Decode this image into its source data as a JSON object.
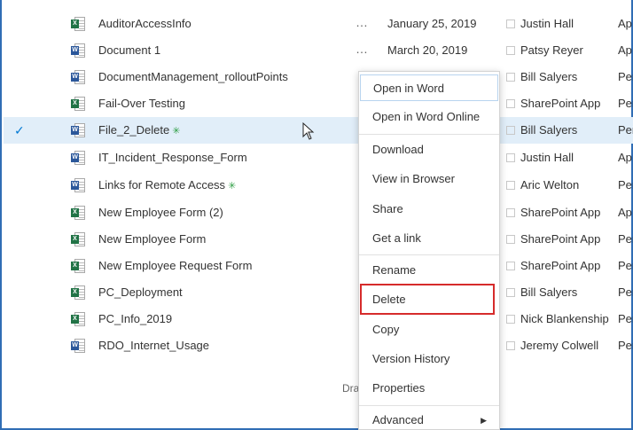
{
  "files": [
    {
      "name": "AuditorAccessInfo",
      "type": "excel",
      "new": false,
      "date": "January 25, 2019",
      "author": "Justin Hall",
      "extra": "Ap",
      "ellipsis": "…"
    },
    {
      "name": "Document 1",
      "type": "word",
      "new": false,
      "date": "March 20, 2019",
      "author": "Patsy Reyer",
      "extra": "Ap",
      "ellipsis": "…"
    },
    {
      "name": "DocumentManagement_rolloutPoints",
      "type": "word",
      "new": false,
      "date": "",
      "author": "Bill Salyers",
      "extra": "Per",
      "ellipsis": ""
    },
    {
      "name": "Fail-Over Testing",
      "type": "excel",
      "new": false,
      "date": "",
      "author": "SharePoint App",
      "extra": "Per",
      "ellipsis": ""
    },
    {
      "name": "File_2_Delete",
      "type": "word",
      "new": true,
      "selected": true,
      "date": "",
      "author": "Bill Salyers",
      "extra": "Per",
      "ellipsis": ""
    },
    {
      "name": "IT_Incident_Response_Form",
      "type": "word",
      "new": false,
      "date": "",
      "author": "Justin Hall",
      "extra": "Ap",
      "ellipsis": ""
    },
    {
      "name": "Links for Remote Access",
      "type": "word",
      "new": true,
      "date": "",
      "author": "Aric Welton",
      "extra": "Per",
      "ellipsis": ""
    },
    {
      "name": "New Employee Form (2)",
      "type": "excel",
      "new": false,
      "date": "",
      "author": "SharePoint App",
      "extra": "Ap",
      "ellipsis": ""
    },
    {
      "name": "New Employee Form",
      "type": "excel",
      "new": false,
      "date": "",
      "author": "SharePoint App",
      "extra": "Per",
      "ellipsis": ""
    },
    {
      "name": "New Employee Request Form",
      "type": "excel",
      "new": false,
      "date": "",
      "author": "SharePoint App",
      "extra": "Per",
      "ellipsis": ""
    },
    {
      "name": "PC_Deployment",
      "type": "excel",
      "new": false,
      "date": "",
      "author": "Bill Salyers",
      "extra": "Per",
      "ellipsis": ""
    },
    {
      "name": "PC_Info_2019",
      "type": "excel",
      "new": false,
      "date": "",
      "author": "Nick Blankenship",
      "extra": "Per",
      "ellipsis": ""
    },
    {
      "name": "RDO_Internet_Usage",
      "type": "word",
      "new": false,
      "date": "",
      "author": "Jeremy Colwell",
      "extra": "Per",
      "ellipsis": ""
    }
  ],
  "icons": {
    "word_badge": "W",
    "excel_badge": "X",
    "new_mark": "✳",
    "check": "✓",
    "submenu_arrow": "▶"
  },
  "drag_hint": "Drag",
  "context_menu": {
    "items": [
      {
        "label": "Open in Word",
        "focused": true
      },
      {
        "label": "Open in Word Online"
      },
      {
        "label": "Download"
      },
      {
        "label": "View in Browser"
      },
      {
        "label": "Share"
      },
      {
        "label": "Get a link"
      },
      {
        "label": "Rename"
      },
      {
        "label": "Delete",
        "highlighted": true
      },
      {
        "label": "Copy"
      },
      {
        "label": "Version History"
      },
      {
        "label": "Properties"
      },
      {
        "label": "Advanced",
        "submenu": true
      }
    ]
  },
  "colors": {
    "accent": "#0078d4",
    "selected_row": "#e1eef9",
    "highlight_box": "#d62b2b",
    "frame_border": "#2f6db5"
  }
}
